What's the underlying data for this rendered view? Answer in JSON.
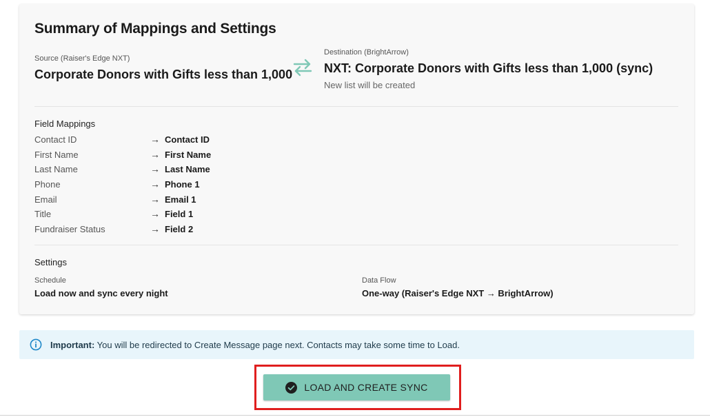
{
  "summary": {
    "title": "Summary of Mappings and Settings",
    "source": {
      "label": "Source (Raiser's Edge NXT)",
      "name": "Corporate Donors with Gifts less than 1,000"
    },
    "destination": {
      "label": "Destination (BrightArrow)",
      "name": "NXT: Corporate Donors with Gifts less than 1,000 (sync)",
      "note": "New list will be created"
    },
    "swap_icon": "swap-arrows-icon"
  },
  "field_mappings": {
    "title": "Field Mappings",
    "arrow": "→",
    "rows": [
      {
        "source": "Contact ID",
        "target": "Contact ID"
      },
      {
        "source": "First Name",
        "target": "First Name"
      },
      {
        "source": "Last Name",
        "target": "Last Name"
      },
      {
        "source": "Phone",
        "target": "Phone 1"
      },
      {
        "source": "Email",
        "target": "Email 1"
      },
      {
        "source": "Title",
        "target": "Field 1"
      },
      {
        "source": "Fundraiser Status",
        "target": "Field 2"
      }
    ]
  },
  "settings": {
    "title": "Settings",
    "schedule": {
      "label": "Schedule",
      "value": "Load now and sync every night"
    },
    "data_flow": {
      "label": "Data Flow",
      "value": "One-way (Raiser's Edge NXT → BrightArrow)"
    }
  },
  "alert": {
    "icon": "info-icon",
    "strong": "Important:",
    "message": "You will be redirected to Create Message page next. Contacts may take some time to Load."
  },
  "action": {
    "icon": "check-circle-icon",
    "label": "LOAD AND CREATE SYNC"
  },
  "colors": {
    "accent": "#7fc8b6",
    "highlight": "#e01e1e",
    "alert_bg": "#e8f5fb",
    "info_icon": "#1e88c9"
  }
}
